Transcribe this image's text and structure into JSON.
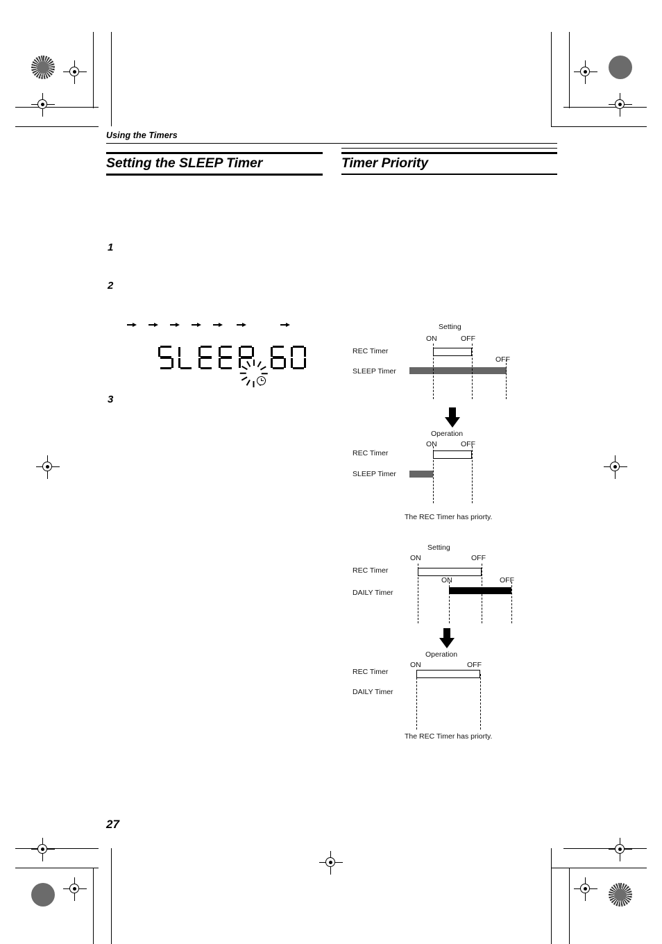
{
  "page": {
    "number": "27",
    "running_head": "Using the Timers"
  },
  "sections": {
    "left_heading": "Setting the SLEEP Timer",
    "right_heading": "Timer Priority"
  },
  "steps": {
    "one": "1",
    "two": "2",
    "three": "3"
  },
  "display": {
    "lcd_text": "SLEEP 60",
    "lcd_chars": [
      "S",
      "L",
      "E",
      "E",
      "P",
      "6",
      "0"
    ],
    "arrow_count": 7,
    "indicator_icon": "blinking-timer-clock-icon"
  },
  "diagrams": [
    {
      "id": "sleep-setting",
      "phase_label": "Setting",
      "rows": [
        {
          "label": "REC Timer",
          "on_label": "ON",
          "off_label": "OFF",
          "style": "outline"
        },
        {
          "label": "SLEEP Timer",
          "on_label": "",
          "off_label": "OFF",
          "style": "gray"
        }
      ],
      "caption": ""
    },
    {
      "id": "sleep-operation",
      "phase_label": "Operation",
      "rows": [
        {
          "label": "REC Timer",
          "on_label": "ON",
          "off_label": "OFF",
          "style": "outline"
        },
        {
          "label": "SLEEP Timer",
          "on_label": "",
          "off_label": "",
          "style": "gray"
        }
      ],
      "caption": "The REC Timer has priorty."
    },
    {
      "id": "daily-setting",
      "phase_label": "Setting",
      "rows": [
        {
          "label": "REC Timer",
          "on_label": "ON",
          "off_label": "OFF",
          "style": "outline"
        },
        {
          "label": "DAILY Timer",
          "on_label": "ON",
          "off_label": "OFF",
          "style": "black"
        }
      ],
      "caption": ""
    },
    {
      "id": "daily-operation",
      "phase_label": "Operation",
      "rows": [
        {
          "label": "REC Timer",
          "on_label": "ON",
          "off_label": "OFF",
          "style": "outline"
        },
        {
          "label": "DAILY Timer",
          "on_label": "",
          "off_label": "",
          "style": "none"
        }
      ],
      "caption": "The REC Timer has priorty."
    }
  ],
  "colors": {
    "sleep_bar": "#666666",
    "daily_bar": "#000000",
    "rule": "#000000",
    "registration": "#6b6b6b"
  },
  "print_marks": {
    "corner_targets": [
      "halftone-target",
      "solid-density-patch",
      "solid-density-patch",
      "halftone-target"
    ],
    "registration_marks": 8
  }
}
